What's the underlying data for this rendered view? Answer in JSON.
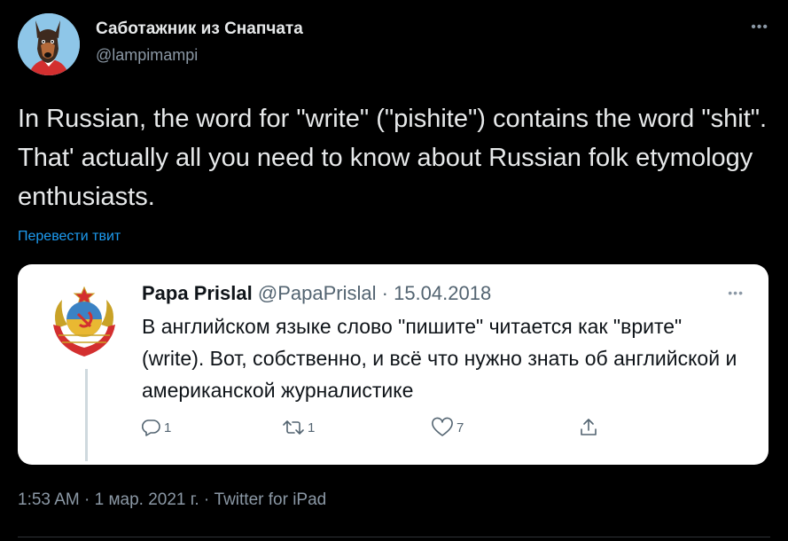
{
  "tweet": {
    "author": {
      "name": "Саботажник из Снапчата",
      "handle": "@lampimampi",
      "avatar_icon": "doberman-dog-avatar"
    },
    "more_icon": "more-options-icon",
    "text": "In Russian, the word for \"write\" (\"pishite\") contains the word \"shit\". That' actually all you need to know about Russian folk etymology enthusiasts.",
    "translate_label": "Перевести твит",
    "meta": "1:53 AM · 1 мар. 2021 г. · Twitter for iPad"
  },
  "quoted_tweet": {
    "author": {
      "name": "Papa Prislal",
      "handle": "@PapaPrislal",
      "date": "15.04.2018",
      "avatar_icon": "ussr-coat-of-arms-avatar"
    },
    "separator": "·",
    "text": "В английском языке слово \"пишите\" читается как \"врите\" (write). Вот, собственно, и всё что нужно знать об английской и американской журналистике",
    "actions": {
      "reply_count": "1",
      "retweet_count": "1",
      "like_count": "7",
      "share_count": ""
    }
  },
  "colors": {
    "background": "#000000",
    "primary_text": "#e7e9ea",
    "secondary_text": "#8b98a5",
    "link": "#1d9bf0",
    "card_background": "#ffffff",
    "card_text": "#0f1419",
    "card_secondary": "#536471"
  }
}
